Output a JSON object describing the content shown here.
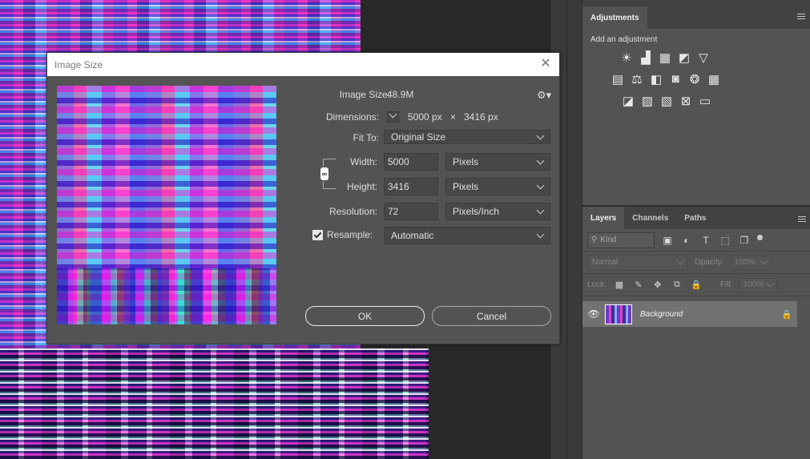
{
  "adjustments_panel": {
    "tab_label": "Adjustments",
    "caption": "Add an adjustment",
    "icons_row1": [
      "brightness-contrast-icon",
      "levels-icon",
      "curves-icon",
      "exposure-icon",
      "vibrance-icon"
    ],
    "icons_row2": [
      "hue-saturation-icon",
      "color-balance-icon",
      "black-white-icon",
      "photo-filter-icon",
      "channel-mixer-icon",
      "color-lookup-icon"
    ],
    "icons_row3": [
      "invert-icon",
      "posterize-icon",
      "threshold-icon",
      "selective-color-icon",
      "gradient-map-icon"
    ]
  },
  "layers_panel": {
    "tabs": [
      "Layers",
      "Channels",
      "Paths"
    ],
    "kind_label": "Kind",
    "blend_mode": "Normal",
    "opacity_label": "Opacity:",
    "opacity_value": "100%",
    "lock_label": "Lock:",
    "fill_label": "Fill:",
    "fill_value": "100%",
    "layer_name": "Background"
  },
  "dialog": {
    "title": "Image Size",
    "image_size_label": "Image Size:",
    "image_size_value": "48.9M",
    "dimensions_label": "Dimensions:",
    "dim_width": "5000 px",
    "dim_times": "×",
    "dim_height": "3416 px",
    "fit_to_label": "Fit To:",
    "fit_to_value": "Original Size",
    "width_label": "Width:",
    "width_value": "5000",
    "width_unit": "Pixels",
    "height_label": "Height:",
    "height_value": "3416",
    "height_unit": "Pixels",
    "resolution_label": "Resolution:",
    "resolution_value": "72",
    "resolution_unit": "Pixels/Inch",
    "resample_label": "Resample:",
    "resample_value": "Automatic",
    "resample_checked": true,
    "ok_label": "OK",
    "cancel_label": "Cancel"
  }
}
